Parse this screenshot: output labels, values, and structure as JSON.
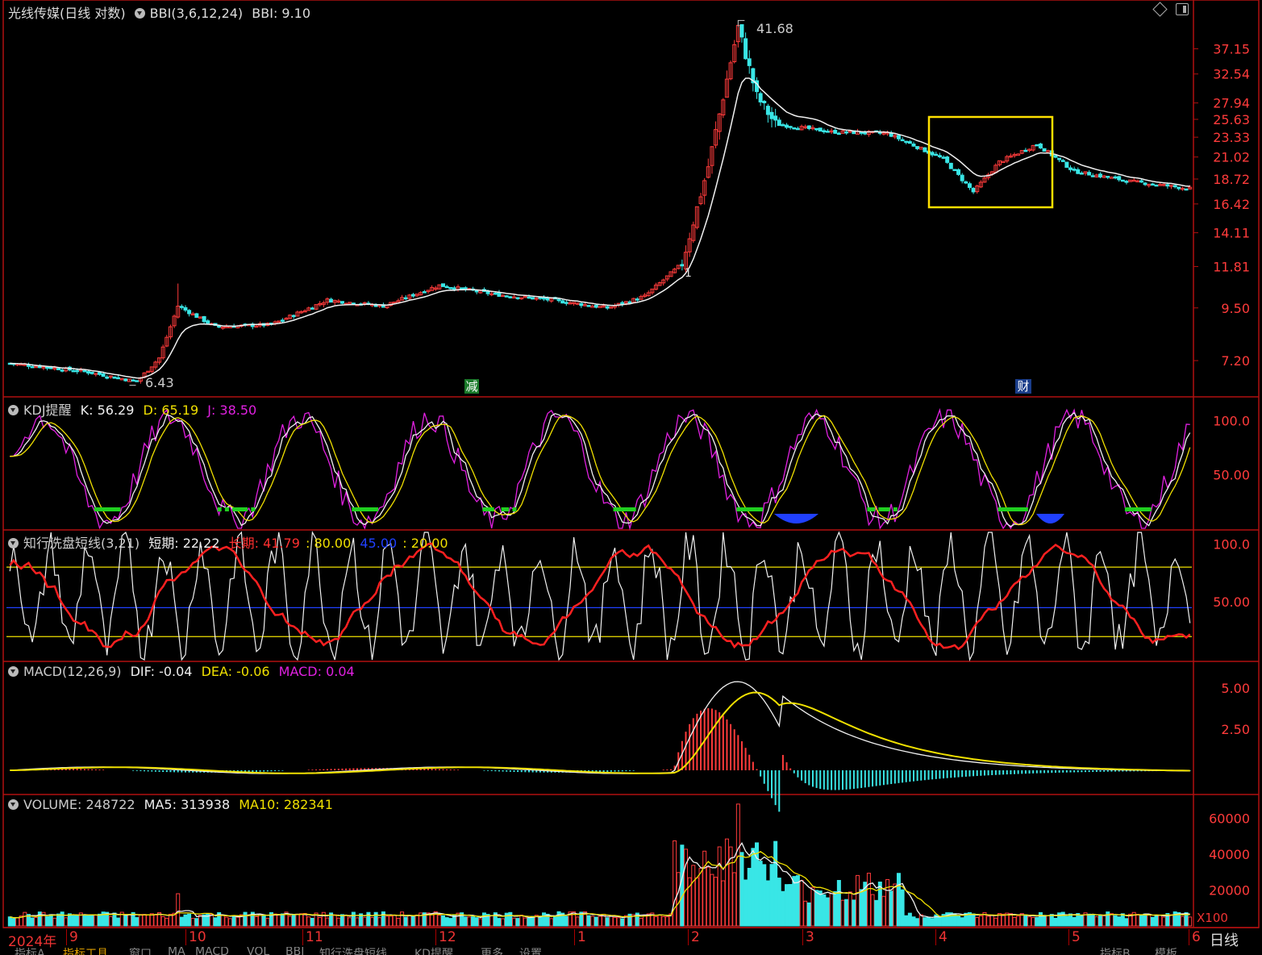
{
  "colors": {
    "up": "#ff3b3b",
    "down": "#39e6e6",
    "frame": "#b01010",
    "yellow": "#f0e000",
    "magenta": "#e020e0",
    "white": "#f0f0f0",
    "blue": "#2040ff",
    "green": "#20d020"
  },
  "header": {
    "stock": "光线传媒(日线 对数)",
    "indicator": "BBI(3,6,12,24)",
    "bbi_label": "BBI: 9.10"
  },
  "kdj": {
    "title": "KDJ提醒",
    "k": "K: 56.29",
    "d": "D: 65.19",
    "j": "J: 38.50"
  },
  "wash": {
    "title": "知行洗盘短线(3,21)",
    "short": "短期: 22.22",
    "long": "长期: 41.79",
    "l80": ": 80.00",
    "l45": "45.00",
    "l20": ": 20.00"
  },
  "macd": {
    "title": "MACD(12,26,9)",
    "dif": "DIF: -0.04",
    "dea": "DEA: -0.06",
    "macd": "MACD: 0.04"
  },
  "volume": {
    "title": "VOLUME: 248722",
    "ma5": "MA5: 313938",
    "ma10": "MA10: 282341",
    "unit": "X100"
  },
  "annotations": {
    "high": "41.68",
    "low": "6.43",
    "mark1": "1",
    "tag_jian": "减",
    "tag_cai": "财"
  },
  "x_axis": {
    "year": "2024年",
    "months": [
      "9",
      "10",
      "11",
      "12",
      "1",
      "2",
      "3",
      "4",
      "5",
      "6"
    ],
    "period": "日线"
  },
  "tabs": [
    "指标A",
    "指标工具",
    "窗口",
    "MA",
    "MACD",
    "VOL",
    "BBI",
    "知行洗盘短线",
    "KD提醒",
    "更多",
    "设置",
    "指标B",
    "模板"
  ],
  "chart_data": [
    {
      "type": "candlestick",
      "title": "光线传媒(日线 对数)",
      "scale": "log",
      "y_ticks": [
        "37.15",
        "32.54",
        "27.94",
        "25.63",
        "23.33",
        "21.02",
        "18.72",
        "16.42",
        "14.11",
        "11.81",
        "9.50",
        "7.20"
      ],
      "anchors": [
        [
          0,
          7.1
        ],
        [
          20,
          6.8
        ],
        [
          34,
          6.45
        ],
        [
          40,
          7.3
        ],
        [
          45,
          9.6
        ],
        [
          55,
          8.6
        ],
        [
          70,
          8.7
        ],
        [
          85,
          9.9
        ],
        [
          100,
          9.6
        ],
        [
          115,
          10.7
        ],
        [
          130,
          10.2
        ],
        [
          145,
          9.9
        ],
        [
          160,
          9.5
        ],
        [
          170,
          10.1
        ],
        [
          180,
          12
        ],
        [
          187,
          20
        ],
        [
          195,
          41.68
        ],
        [
          200,
          29
        ],
        [
          205,
          25
        ],
        [
          220,
          24
        ],
        [
          235,
          23.8
        ],
        [
          250,
          20.8
        ],
        [
          258,
          17.5
        ],
        [
          265,
          20.5
        ],
        [
          275,
          22.5
        ],
        [
          285,
          19.5
        ],
        [
          300,
          18.5
        ],
        [
          316,
          17.8
        ]
      ],
      "series": [
        {
          "name": "BBI",
          "last": "9.10"
        }
      ],
      "high": "41.68",
      "low": "6.43"
    },
    {
      "type": "line",
      "title": "KDJ提醒",
      "y_ticks": [
        "100.0",
        "50.00"
      ],
      "series": [
        {
          "name": "K",
          "last": 56.29
        },
        {
          "name": "D",
          "last": 65.19
        },
        {
          "name": "J",
          "last": 38.5
        }
      ]
    },
    {
      "type": "line",
      "title": "知行洗盘短线(3,21)",
      "y_ticks": [
        "100.0",
        "50.00"
      ],
      "levels": [
        80,
        45,
        20
      ],
      "series": [
        {
          "name": "短期",
          "last": 22.22
        },
        {
          "name": "长期",
          "last": 41.79
        }
      ]
    },
    {
      "type": "bar",
      "title": "MACD(12,26,9)",
      "y_ticks": [
        "5.00",
        "2.50"
      ],
      "series": [
        {
          "name": "DIF",
          "last": -0.04
        },
        {
          "name": "DEA",
          "last": -0.06
        },
        {
          "name": "MACD",
          "last": 0.04
        }
      ]
    },
    {
      "type": "bar",
      "title": "VOLUME",
      "y_ticks": [
        "60000",
        "40000",
        "20000"
      ],
      "series": [
        {
          "name": "VOLUME",
          "last": 248722
        },
        {
          "name": "MA5",
          "last": 313938
        },
        {
          "name": "MA10",
          "last": 282341
        }
      ]
    }
  ]
}
